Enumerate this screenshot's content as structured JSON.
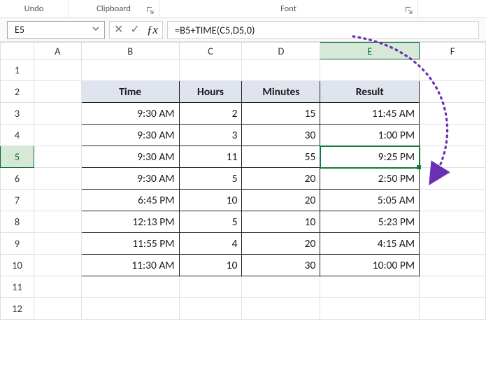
{
  "ribbon": {
    "group_undo": "Undo",
    "group_clipboard": "Clipboard",
    "group_font": "Font"
  },
  "formula_bar": {
    "name_box": "E5",
    "formula": "=B5+TIME(C5,D5,0)"
  },
  "columns": [
    "A",
    "B",
    "C",
    "D",
    "E",
    "F"
  ],
  "rows": [
    "1",
    "2",
    "3",
    "4",
    "5",
    "6",
    "7",
    "8",
    "9",
    "10",
    "11",
    "12"
  ],
  "active": {
    "col": "E",
    "row": "5"
  },
  "headers": {
    "time": "Time",
    "hours": "Hours",
    "minutes": "Minutes",
    "result": "Result"
  },
  "data": [
    {
      "time": "9:30 AM",
      "hours": "2",
      "minutes": "15",
      "result": "11:45 AM"
    },
    {
      "time": "9:30 AM",
      "hours": "3",
      "minutes": "30",
      "result": "1:00 PM"
    },
    {
      "time": "9:30 AM",
      "hours": "11",
      "minutes": "55",
      "result": "9:25 PM"
    },
    {
      "time": "9:30 AM",
      "hours": "5",
      "minutes": "20",
      "result": "2:50 PM"
    },
    {
      "time": "6:45 PM",
      "hours": "10",
      "minutes": "20",
      "result": "5:05 AM"
    },
    {
      "time": "12:13 PM",
      "hours": "5",
      "minutes": "10",
      "result": "5:23 PM"
    },
    {
      "time": "11:55 PM",
      "hours": "4",
      "minutes": "20",
      "result": "4:15 AM"
    },
    {
      "time": "11:30 AM",
      "hours": "10",
      "minutes": "30",
      "result": "10:00 PM"
    }
  ]
}
